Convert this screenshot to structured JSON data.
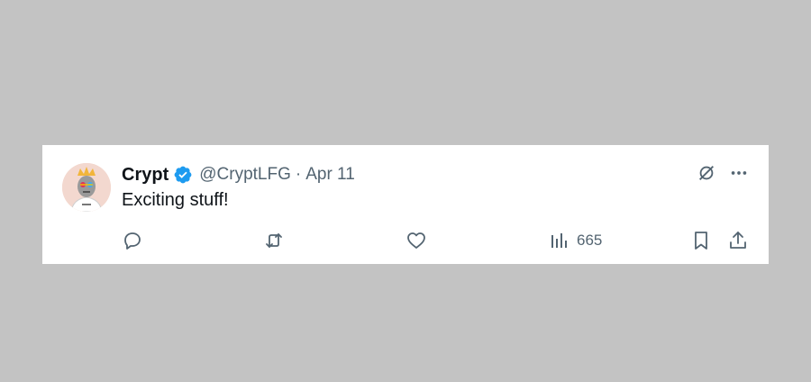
{
  "tweet": {
    "display_name": "Crypt",
    "handle": "@CryptLFG",
    "separator": "·",
    "timestamp": "Apr 11",
    "text": "Exciting stuff!",
    "verified": true
  },
  "actions": {
    "reply_icon": "reply-icon",
    "retweet_icon": "retweet-icon",
    "like_icon": "heart-icon",
    "views_icon": "views-chart-icon",
    "views_count": "665",
    "bookmark_icon": "bookmark-icon",
    "share_icon": "share-icon"
  },
  "top_icons": {
    "grok": "grok-icon",
    "more": "more-options-icon"
  },
  "colors": {
    "background": "#c3c3c3",
    "card": "#ffffff",
    "text_primary": "#0f1419",
    "text_secondary": "#536471",
    "verified": "#1d9bf0"
  }
}
